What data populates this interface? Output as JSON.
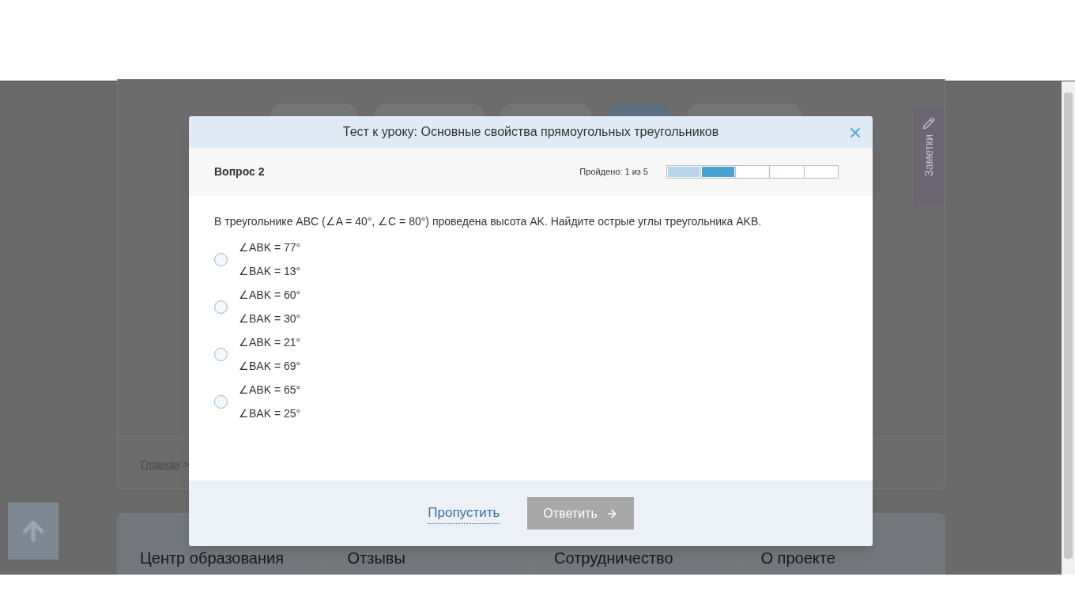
{
  "lesson_tabs": [
    {
      "selected": false
    },
    {
      "selected": false
    },
    {
      "selected": false
    },
    {
      "selected": true
    },
    {
      "selected": false
    }
  ],
  "notes_tab": {
    "label": "Заметки"
  },
  "breadcrumb": {
    "link": "Главная",
    "separator": ">"
  },
  "footer": {
    "columns": [
      "Центр образования",
      "Отзывы",
      "Сотрудничество",
      "О проекте"
    ]
  },
  "modal": {
    "title": "Тест к уроку: Основные свойства прямоугольных треугольников",
    "question_label": "Вопрос 2",
    "progress_text": "Пройдено: 1 из 5",
    "progress": [
      {
        "kind": "done"
      },
      {
        "kind": "current"
      },
      {
        "kind": "pending"
      },
      {
        "kind": "pending"
      },
      {
        "kind": "pending"
      }
    ],
    "question": "В треугольнике ABC (∠A = 40°, ∠C = 80°) проведена высота AK. Найдите острые углы треугольника AKB.",
    "options": [
      {
        "lines": [
          "∠ABK = 77°",
          "∠BAK = 13°"
        ],
        "selected": false
      },
      {
        "lines": [
          "∠ABK = 60°",
          "∠BAK = 30°"
        ],
        "selected": false
      },
      {
        "lines": [
          "∠ABK = 21°",
          "∠BAK = 69°"
        ],
        "selected": false
      },
      {
        "lines": [
          "∠ABK = 65°",
          "∠BAK = 25°"
        ],
        "selected": false
      }
    ],
    "skip": "Пропустить",
    "submit": {
      "label": "Ответить",
      "disabled": true
    }
  }
}
